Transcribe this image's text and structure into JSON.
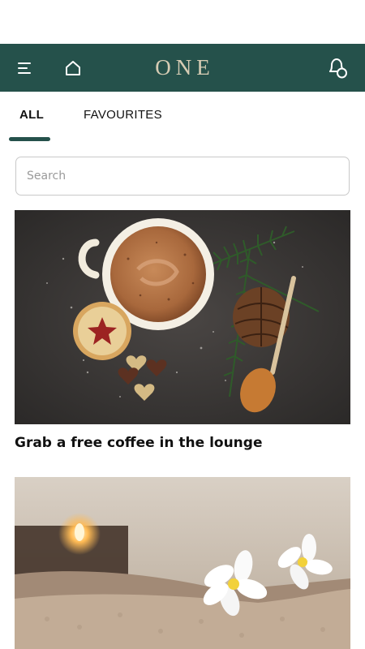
{
  "header": {
    "brand": "ONE",
    "menu_icon": "hamburger-menu-icon",
    "home_icon": "home-icon",
    "notification_icon": "bell-notification-icon",
    "background_color": "#25514b",
    "brand_color": "#d6ccb4"
  },
  "tabs": {
    "all_label": "ALL",
    "favourites_label": "FAVOURITES",
    "active": "ALL",
    "indicator_color": "#25514b"
  },
  "search": {
    "placeholder": "Search",
    "value": ""
  },
  "feed": {
    "items": [
      {
        "title": "Grab a free coffee in the lounge",
        "image": "coffee-cup-with-cookies-and-pinecone"
      },
      {
        "title": "",
        "image": "spa-towel-with-frangipani-flowers-and-candle"
      }
    ]
  }
}
